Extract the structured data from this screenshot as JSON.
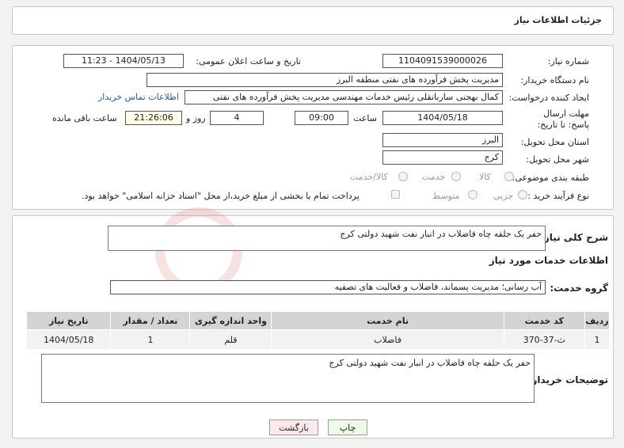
{
  "header": {
    "title": "جزئیات اطلاعات نیاز"
  },
  "details": {
    "need_number_label": "شماره نیاز:",
    "need_number_value": "1104091539000026",
    "announce_label": "تاریخ و ساعت اعلان عمومی:",
    "announce_value": "1404/05/13 - 11:23",
    "buyer_org_label": "نام دستگاه خریدار:",
    "buyer_org_value": "مدیریت پخش فرآورده های نفتی منطقه البرز",
    "creator_label": "ایجاد کننده درخواست:",
    "creator_value": "کمال بهجتی ساربانقلی رئیس خدمات مهندسی  مدیریت پخش فرآورده های نفتی",
    "contact_link": "اطلاعات تماس خریدار",
    "deadline_label": "مهلت ارسال پاسخ: تا تاریخ:",
    "deadline_date": "1404/05/18",
    "time_label": "ساعت",
    "deadline_time": "09:00",
    "days_value": "4",
    "days_label": "روز و",
    "remaining_time": "21:26:06",
    "remaining_label": "ساعت باقی مانده",
    "province_label": "استان محل تحویل:",
    "province_value": "البرز",
    "city_label": "شهر محل تحویل:",
    "city_value": "کرج",
    "category_label": "طبقه بندی موضوعی:",
    "category_options": [
      "کالا",
      "خدمت",
      "کالا/خدمت"
    ],
    "process_label": "نوع فرآیند خرید :",
    "process_options": [
      "جزیی",
      "متوسط"
    ],
    "payment_note": "پرداخت تمام یا بخشی از مبلغ خرید،از محل \"اسناد خزانه اسلامی\" خواهد بود."
  },
  "summary": {
    "label": "شرح کلی نیاز:",
    "value": "حفر یک حلقه چاه فاضلاب در انبار نفت شهید دولتی کرج",
    "services_heading": "اطلاعات خدمات مورد نیاز",
    "group_label": "گروه خدمت:",
    "group_value": "آب رسانی؛ مدیریت پسماند، فاضلاب و فعالیت های تصفیه"
  },
  "table": {
    "headers": [
      "ردیف",
      "کد خدمت",
      "نام خدمت",
      "واحد اندازه گیری",
      "تعداد / مقدار",
      "تاریخ نیاز"
    ],
    "rows": [
      [
        "1",
        "ث-37-370",
        "فاضلاب",
        "قلم",
        "1",
        "1404/05/18"
      ]
    ]
  },
  "buyer_notes": {
    "label": "توضیحات خریدار:",
    "value": "حفر یک حلقه چاه فاضلاب در انبار نفت شهید دولتی کرج"
  },
  "buttons": {
    "print": "چاپ",
    "back": "بازگشت"
  }
}
